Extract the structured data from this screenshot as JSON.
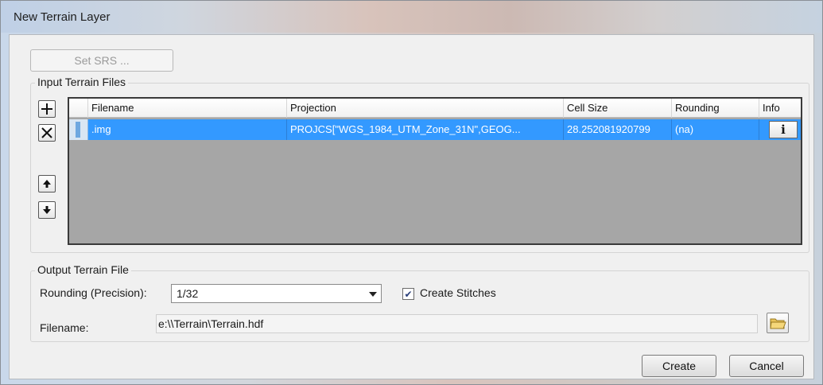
{
  "window": {
    "title": "New Terrain Layer",
    "accent_color": "#3399ff"
  },
  "set_srs": {
    "label": "Set SRS ...",
    "enabled": false
  },
  "input_group": {
    "label": "Input Terrain Files",
    "side_buttons": [
      {
        "name": "add",
        "glyph": "+",
        "icon": "plus-icon"
      },
      {
        "name": "remove",
        "glyph": "✕",
        "icon": "close-icon"
      },
      {
        "name": "move-up",
        "glyph": "↑",
        "icon": "arrow-up-icon"
      },
      {
        "name": "move-down",
        "glyph": "↓",
        "icon": "arrow-down-icon"
      }
    ],
    "table": {
      "columns": [
        "Filename",
        "Projection",
        "Cell Size",
        "Rounding",
        "Info"
      ],
      "rows": [
        {
          "filename": ".img",
          "projection": "PROJCS[\"WGS_1984_UTM_Zone_31N\",GEOG...",
          "cell_size": "28.252081920799",
          "rounding": "(na)",
          "info_glyph": "i",
          "selected": true
        }
      ]
    }
  },
  "output_group": {
    "label": "Output Terrain File",
    "rounding_label": "Rounding (Precision):",
    "rounding_value": "1/32",
    "create_stitches_label": "Create Stitches",
    "create_stitches_checked": true,
    "check_glyph": "✔",
    "filename_label": "Filename:",
    "filename_value": "e:\\\\Terrain\\Terrain.hdf"
  },
  "footer": {
    "create_label": "Create",
    "cancel_label": "Cancel"
  }
}
